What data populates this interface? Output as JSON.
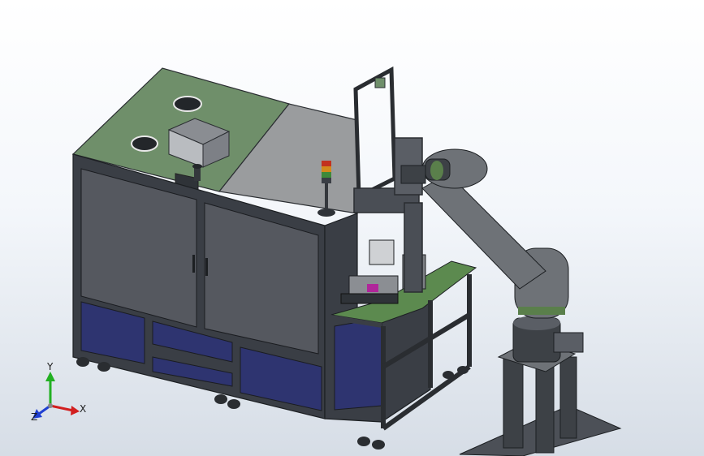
{
  "viewport": {
    "background_top": "#ffffff",
    "background_bottom": "#d6dde6"
  },
  "colors": {
    "frame": "#3a3e45",
    "frame_light": "#6a7078",
    "top_green": "#6f8f6a",
    "top_grey": "#9a9c9e",
    "door_panel": "#55585f",
    "lower_panel": "#2e3470",
    "pcb_green": "#5c8a4f",
    "robot_grey": "#6e7277",
    "robot_dark": "#3d4146",
    "robot_ring": "#5a7f4b",
    "magenta": "#b0269a",
    "tower_red": "#c2321f",
    "tower_orange": "#d38a1c",
    "tower_green": "#3f8a3a"
  },
  "axis_triad": {
    "x_label": "X",
    "y_label": "Y",
    "z_label": "Z",
    "x_color": "#d21f1f",
    "y_color": "#22b022",
    "z_color": "#1f3fd2"
  }
}
